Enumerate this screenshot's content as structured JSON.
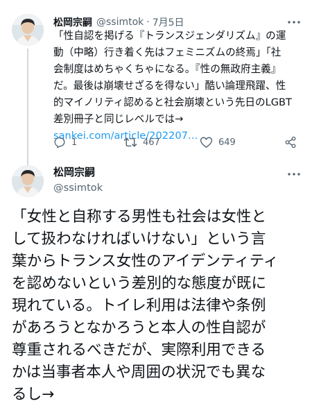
{
  "tweet1": {
    "author_name": "松岡宗嗣",
    "handle": "@ssimtok",
    "separator": "·",
    "date": "7月5日",
    "lines": [
      "「性自認を掲げる『トランスジェンダリズム』の運",
      "動（中略）行き着く先はフェミニズムの終焉」「社",
      "会制度はめちゃくちゃになる。『性の無政府主義』",
      "だ。最後は崩壊せざるを得ない」酷い論理飛躍、性",
      "的マイノリティ認めると社会崩壊という先日のLGBT",
      "差別冊子と同じレベルでは→"
    ],
    "link": "sankei.com/article/202207…",
    "reply_count": "1",
    "retweet_count": "467",
    "like_count": "649"
  },
  "tweet2": {
    "author_name": "松岡宗嗣",
    "handle": "@ssimtok",
    "lines": [
      "「女性と自称する男性も社会は女性と",
      "して扱わなければいけない」という言",
      "葉からトランス女性のアイデンティティ",
      "を認めないという差別的な態度が既に",
      "現れている。トイレ利用は法律や条例",
      "があろうとなかろうと本人の性自認が",
      "尊重されるべきだが、実際利用できる",
      "かは当事者本人や周囲の状況でも異な",
      "るし→"
    ]
  },
  "icons": {
    "more": "more-icon",
    "reply": "reply-icon",
    "retweet": "retweet-icon",
    "like": "heart-icon",
    "share": "share-icon"
  },
  "colors": {
    "text": "#0f1419",
    "secondary": "#536471",
    "link": "#1d9bf0",
    "thread_line": "#cfd9de"
  }
}
